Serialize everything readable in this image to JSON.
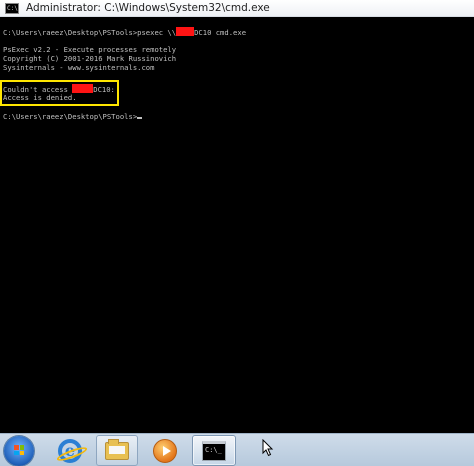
{
  "window": {
    "title": "Administrator: C:\\Windows\\System32\\cmd.exe",
    "title_icon_glyph": "C:\\"
  },
  "console": {
    "lines": [
      {
        "pre": "C:\\Users\\raeez\\Desktop\\PSTools>psexec \\\\",
        "post": "DC10 cmd.exe"
      },
      {
        "text": "PsExec v2.2 - Execute processes remotely"
      },
      {
        "text": "Copyright (C) 2001-2016 Mark Russinovich"
      },
      {
        "text": "Sysinternals - www.sysinternals.com"
      },
      {
        "pre": "Couldn't access ",
        "post": "DC10:"
      },
      {
        "text": "Access is denied."
      },
      {
        "text": "C:\\Users\\raeez\\Desktop\\PSTools>"
      }
    ],
    "text_color": "#c0c0c0",
    "background": "#000000",
    "highlight_color": "#ffe600",
    "redaction_color": "#ff1414"
  },
  "taskbar": {
    "items": [
      {
        "icon": "windows-start-orb-icon"
      },
      {
        "icon": "internet-explorer-icon",
        "glyph": "e"
      },
      {
        "icon": "folder-icon"
      },
      {
        "icon": "media-player-icon"
      },
      {
        "icon": "command-prompt-icon",
        "glyph": "C:\\_"
      }
    ]
  }
}
